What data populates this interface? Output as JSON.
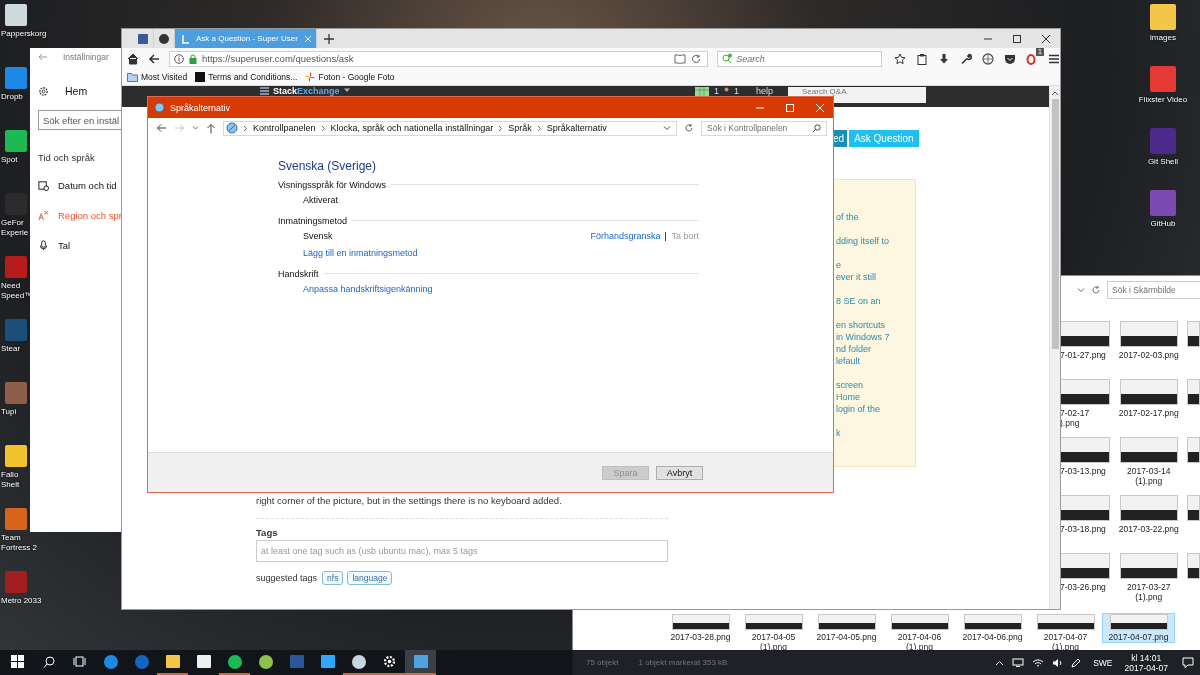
{
  "desktop": {
    "left_icons": [
      {
        "label": "Papperskorg",
        "color": "#cfd8dc"
      },
      {
        "label": "Dropb",
        "color": "#1e88e5"
      },
      {
        "label": "Spot",
        "color": "#1db954"
      },
      {
        "label": "GeFor\nExperie",
        "color": "#2b2b2b"
      },
      {
        "label": "Need\nSpeed™",
        "color": "#b71c1c"
      },
      {
        "label": "Stear",
        "color": "#1b4f7a"
      },
      {
        "label": "Tupi",
        "color": "#8d5e4a"
      },
      {
        "label": "Fallo\nShelt",
        "color": "#f2c230"
      },
      {
        "label": "Team\nFortress 2",
        "color": "#d8641c"
      },
      {
        "label": "Metro 2033",
        "color": "#a31f1f"
      }
    ],
    "right_icons": [
      {
        "label": "images",
        "color": "#f3c64a"
      },
      {
        "label": "Flixster Video",
        "color": "#e53935"
      },
      {
        "label": "Git Shell",
        "color": "#4a2a8a"
      },
      {
        "label": "GitHub",
        "color": "#7b4bb3"
      }
    ]
  },
  "settings_window": {
    "title": "Inställningar",
    "home": "Hem",
    "search": {
      "placeholder": "Sök efter en instäl"
    },
    "section": "Tid och språk",
    "items": [
      {
        "label": "Datum och tid",
        "kind": "clock",
        "selected": false
      },
      {
        "label": "Region och spr",
        "kind": "region",
        "selected": true
      },
      {
        "label": "Tal",
        "kind": "mic",
        "selected": false
      }
    ]
  },
  "browser": {
    "tabs": [
      {
        "kind": "square",
        "selected": false
      },
      {
        "kind": "circle",
        "selected": false
      },
      {
        "kind": "page",
        "label": "Ask a Question - Super User",
        "selected": true
      }
    ],
    "url": "https://superuser.com/questions/ask",
    "search": {
      "placeholder": "Search"
    },
    "toolbar_badge": "1",
    "bookmarks": [
      {
        "label": "Most Visited",
        "kind": "folder"
      },
      {
        "label": "Terms and Conditions...",
        "kind": "square"
      },
      {
        "label": "Foton - Google Foto",
        "kind": "pinwheel"
      }
    ],
    "site_bar": {
      "logo": {
        "first": "Stack",
        "second": "Exchange"
      },
      "counts": [
        "1",
        "1"
      ],
      "help": "help",
      "search": {
        "placeholder": "Search Q&A"
      }
    },
    "sidebar_buttons": [
      "ed",
      "Ask Question"
    ],
    "help_paragraphs": [
      [
        "of the"
      ],
      [
        "dding itself to"
      ],
      [
        "e",
        "ever it still"
      ],
      [
        "8 SE on an"
      ],
      [
        "en shortcuts",
        "in Windows 7",
        "nd folder",
        "lefault"
      ],
      [
        "screen",
        "Home",
        "login of the"
      ],
      [
        "k"
      ]
    ],
    "question_text": "right corner of the picture, but in the settings there is no keyboard added.",
    "tags": {
      "label": "Tags",
      "placeholder": "at least one tag such as (usb ubuntu mac), max 5 tags"
    },
    "suggested": {
      "label": "suggested tags",
      "tags": [
        "nfs",
        "language"
      ]
    }
  },
  "dialog": {
    "title": "Språkalternativ",
    "forward": {
      "disabled": true
    },
    "breadcrumbs": [
      "Kontrollpanelen",
      "Klocka, språk och nationella inställningar",
      "Språk",
      "Språkalternativ"
    ],
    "search": {
      "placeholder": "Sök i Kontrollpanelen"
    },
    "language": "Svenska (Sverige)",
    "sections": [
      {
        "heading": "Visningsspråk för Windows",
        "items": [
          {
            "kind": "text",
            "label": "Aktiverat"
          }
        ]
      },
      {
        "heading": "Inmatningsmetod",
        "items": [
          {
            "kind": "method",
            "label": "Svensk",
            "actions": [
              {
                "label": "Förhandsgranska",
                "disabled": false
              },
              {
                "label": "Ta bort",
                "disabled": true
              }
            ]
          },
          {
            "kind": "link",
            "label": "Lägg till en inmatningsmetod"
          }
        ]
      },
      {
        "heading": "Handskrift",
        "items": [
          {
            "kind": "link",
            "label": "Anpassa handskriftsigenkänning"
          }
        ]
      }
    ],
    "buttons": [
      {
        "label": "Spara",
        "disabled": true
      },
      {
        "label": "Avbryt",
        "disabled": false
      }
    ]
  },
  "explorer": {
    "search": {
      "placeholder": "Sök i Skärmbilde"
    },
    "grid_rows": [
      [
        "7-01-27.png",
        "2017-02-03.png"
      ],
      [
        "7-02-17\n).png",
        "2017-02-17.png"
      ],
      [
        "7-03-13.png",
        "2017-03-14\n(1).png"
      ],
      [
        "7-03-18.png",
        "2017-03-22.png"
      ],
      [
        "7-03-26.png",
        "2017-03-27\n(1).png"
      ]
    ],
    "bottom_row": [
      {
        "label": "2017-03-28.png",
        "selected": false
      },
      {
        "label": "2017-04-05\n(1).png",
        "selected": false
      },
      {
        "label": "2017-04-05.png",
        "selected": false
      },
      {
        "label": "2017-04-06\n(1).png",
        "selected": false
      },
      {
        "label": "2017-04-06.png",
        "selected": false
      },
      {
        "label": "2017-04-07\n(1).png",
        "selected": false
      },
      {
        "label": "2017-04-07.png",
        "selected": true
      }
    ],
    "status_bar": [
      "75 objekt",
      "1 objekt markerat 353 kB"
    ]
  },
  "taskbar": {
    "items": [
      {
        "kind": "start",
        "running": false,
        "selected": false
      },
      {
        "kind": "search",
        "running": false,
        "selected": false
      },
      {
        "kind": "taskview",
        "running": false,
        "selected": false
      },
      {
        "kind": "circle",
        "color": "#1e88e5",
        "running": false,
        "selected": false
      },
      {
        "kind": "circle",
        "color": "#1565c0",
        "running": false,
        "selected": false
      },
      {
        "kind": "tile",
        "color": "#f3c64a",
        "running": true,
        "selected": false
      },
      {
        "kind": "tile",
        "color": "#eeeeee",
        "running": false,
        "selected": false
      },
      {
        "kind": "circle",
        "color": "#1db954",
        "running": true,
        "selected": false
      },
      {
        "kind": "circle",
        "color": "#8bc34a",
        "running": false,
        "selected": false
      },
      {
        "kind": "tile",
        "color": "#2b579a",
        "running": false,
        "selected": false
      },
      {
        "kind": "tile",
        "color": "#31a8ff",
        "running": false,
        "selected": false
      },
      {
        "kind": "circle",
        "color": "#c7d5e0",
        "running": true,
        "selected": false
      },
      {
        "kind": "gear",
        "running": true,
        "selected": false
      },
      {
        "kind": "tile",
        "color": "#4fa3e0",
        "running": true,
        "selected": true
      }
    ],
    "tray": {
      "language": "SWE",
      "time": "kl 14:01",
      "date": "2017-04-07"
    }
  }
}
